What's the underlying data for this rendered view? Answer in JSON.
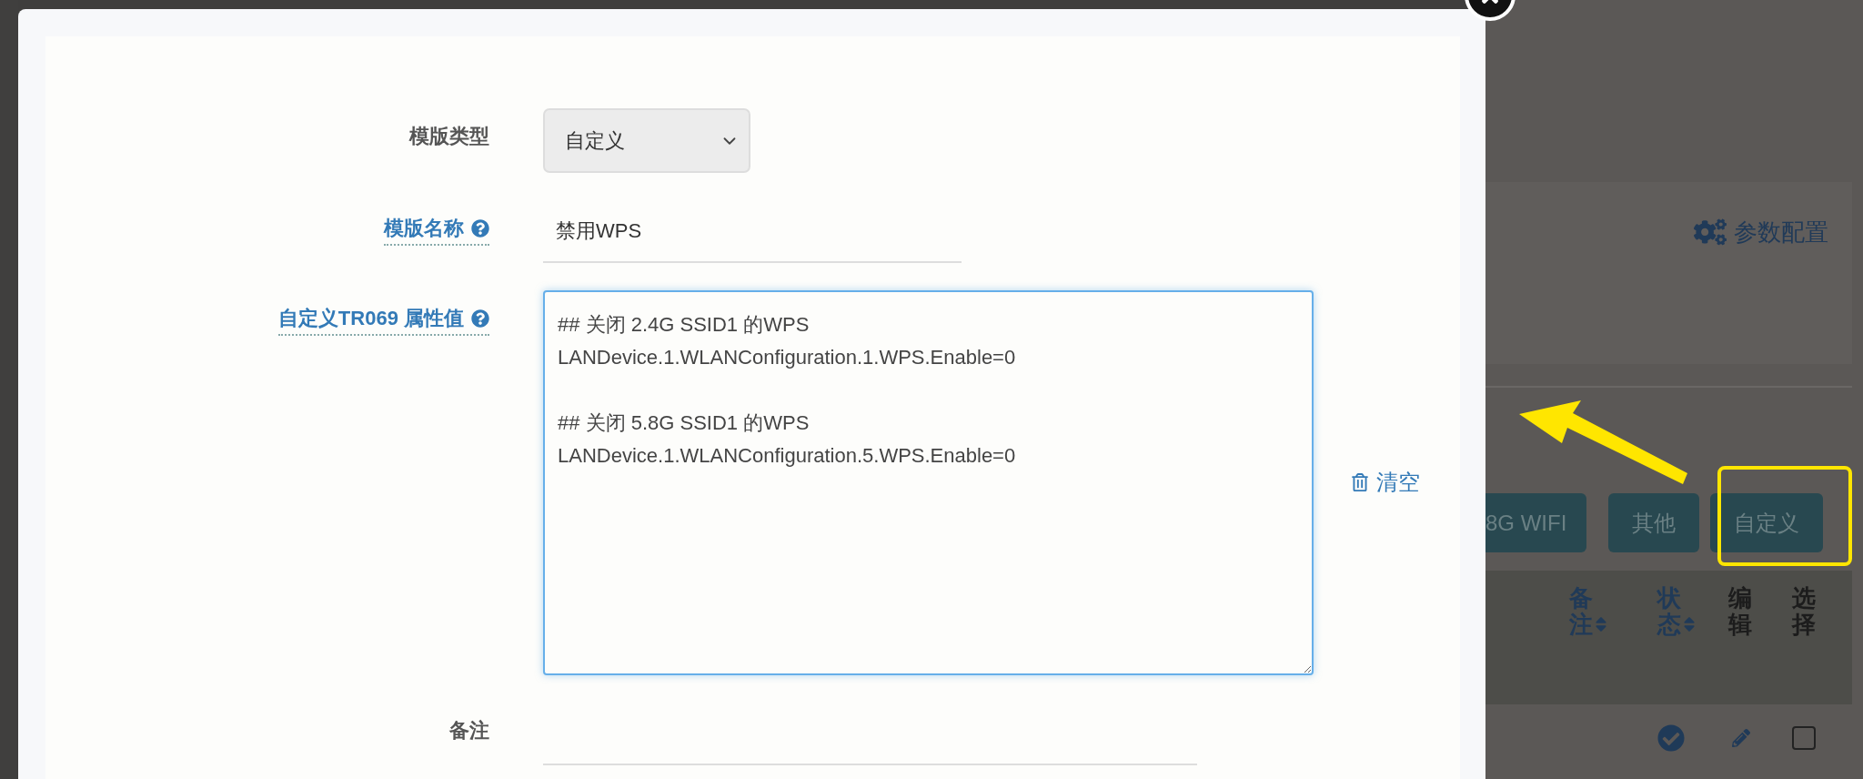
{
  "modal": {
    "fields": [
      {
        "kind": "select",
        "label": "模版类型",
        "value": "自定义",
        "help": false
      },
      {
        "kind": "text",
        "label": "模版名称",
        "value": "禁用WPS",
        "help": true
      },
      {
        "kind": "textarea",
        "label": "自定义TR069 属性值",
        "value": "## 关闭 2.4G SSID1 的WPS\nLANDevice.1.WLANConfiguration.1.WPS.Enable=0\n\n## 关闭 5.8G SSID1 的WPS\nLANDevice.1.WLANConfiguration.5.WPS.Enable=0",
        "help": true,
        "action": "清空"
      },
      {
        "kind": "text",
        "label": "备注",
        "help": false
      }
    ]
  },
  "background": {
    "settings_link": "参数配置",
    "filter_buttons": [
      {
        "label": "8G WIFI",
        "highlighted": false
      },
      {
        "label": "其他",
        "highlighted": false
      },
      {
        "label": "自定义",
        "highlighted": true
      }
    ],
    "table": {
      "columns": [
        {
          "label": "备注",
          "sortable": true
        },
        {
          "label": "状态",
          "sortable": true
        },
        {
          "label": "编辑",
          "sortable": false
        },
        {
          "label": "选择",
          "sortable": false
        }
      ],
      "rows": [
        {
          "enabled": true,
          "checked": false
        }
      ]
    }
  }
}
